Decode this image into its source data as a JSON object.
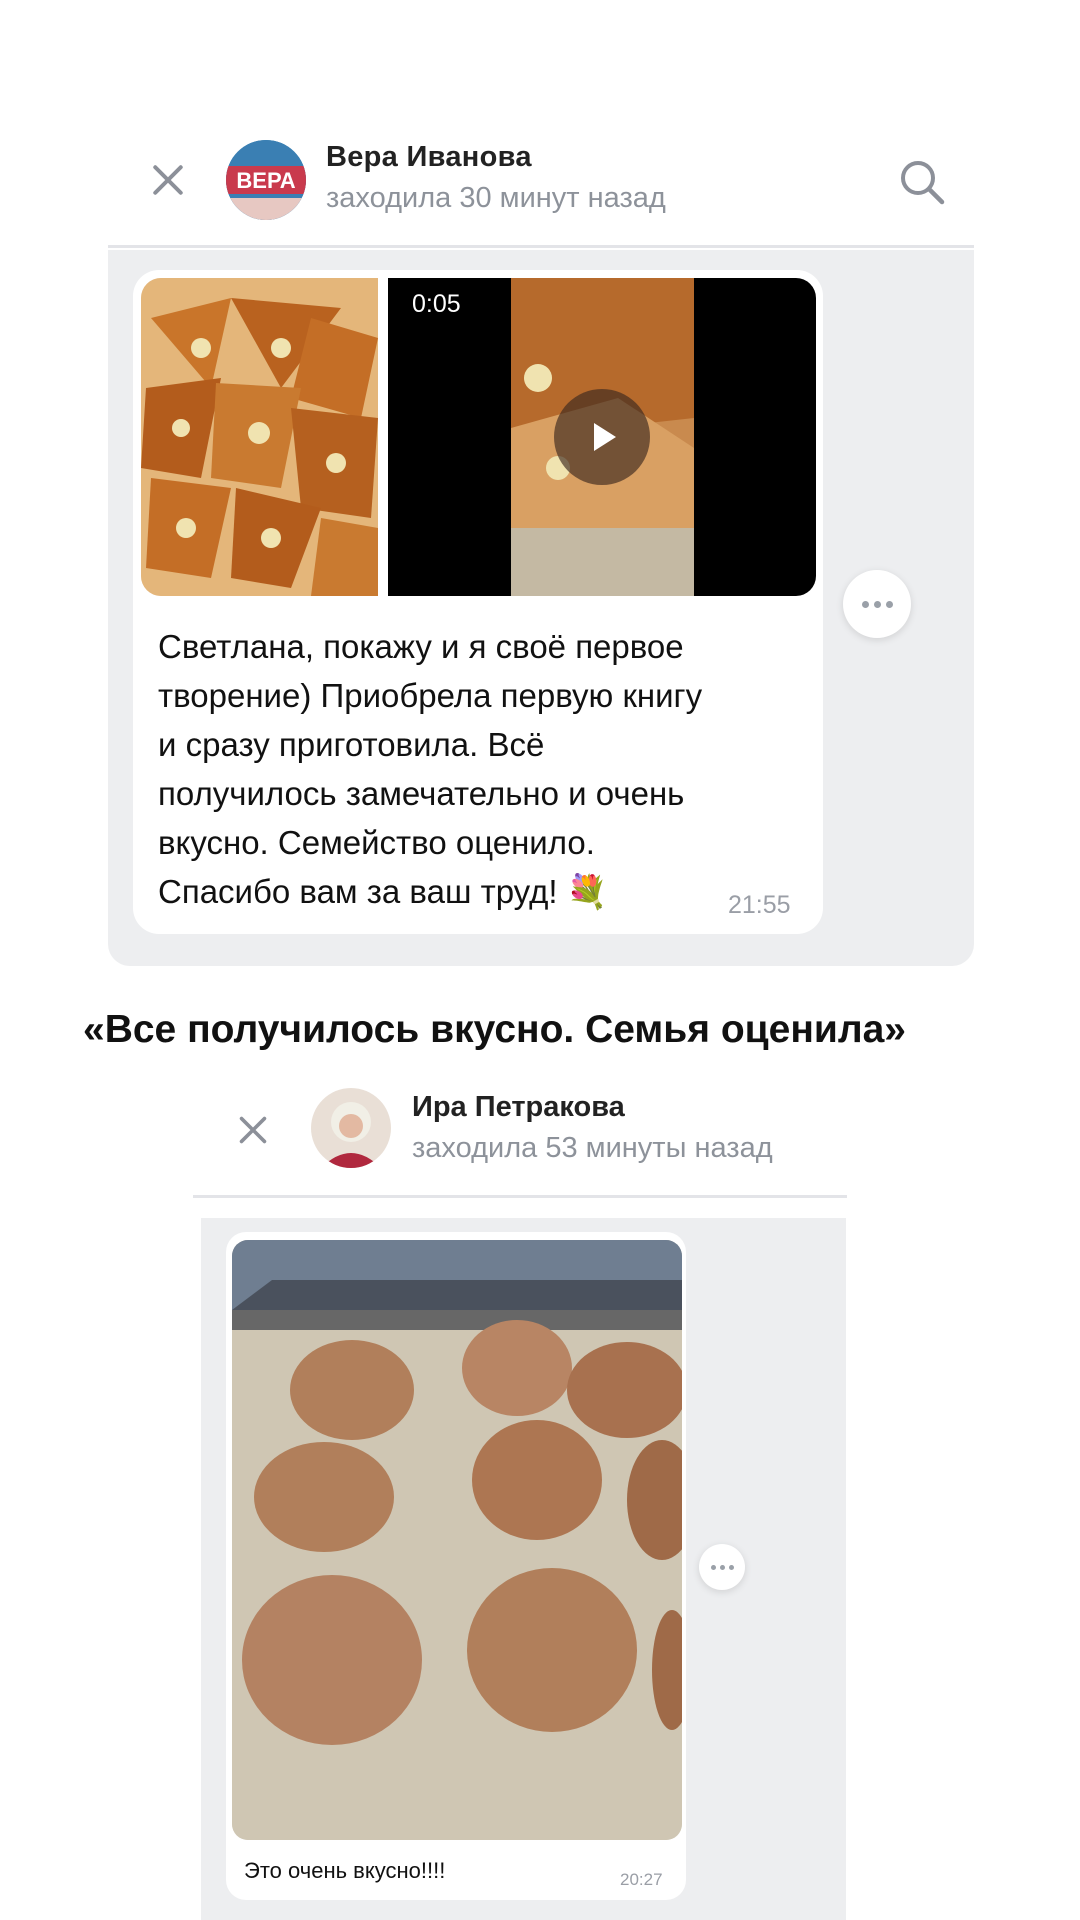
{
  "chat1": {
    "contact_name": "Вера Иванова",
    "contact_status": "заходила 30 минут назад",
    "avatar_icon": "avatar-icon",
    "close_icon": "close-icon",
    "search_icon": "search-icon",
    "video_duration": "0:05",
    "message_lines": [
      "Светлана, покажу и я своё первое",
      "творение) Приобрела первую книгу",
      "и  сразу приготовила. Всё",
      "получилось замечательно и очень",
      "вкусно. Семейство оценило.",
      "Спасибо вам за ваш труд! 💐"
    ],
    "time": "21:55"
  },
  "heading": "«Все получилось вкусно. Семья оценила»",
  "chat2": {
    "contact_name": "Ира Петракова",
    "contact_status": "заходила 53 минуты назад",
    "message": "Это очень вкусно!!!!",
    "time": "20:27"
  },
  "colors": {
    "chat_background": "#edeef0",
    "status_gray": "#8d929a",
    "bubble": "#ffffff"
  }
}
